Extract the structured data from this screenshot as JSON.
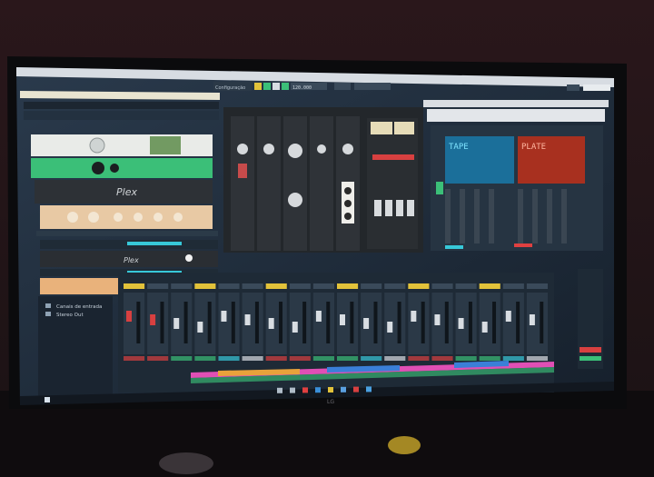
{
  "monitor": {
    "brand_mark": "LG"
  },
  "daw": {
    "toolbar": {
      "zoom_text": "Configuração",
      "tempo_text": "120.000"
    },
    "track_list": [
      {
        "label": "Canais de entrada"
      },
      {
        "label": "Stereo Out"
      }
    ],
    "plugins": {
      "plex_label_1": "Plex",
      "plex_label_2": "Plex",
      "tape_display_text": "TAPE",
      "plate_display_text": "PLATE"
    },
    "mixer": {
      "channel_count": 18
    },
    "colors": {
      "accent_green": "#3bbf78",
      "accent_cyan": "#37c8d8",
      "accent_pink": "#e04fb5",
      "panel": "#1e2a36",
      "rack": "#23272b"
    }
  },
  "taskbar": {
    "icons": [
      "windows-icon",
      "search-icon",
      "task-view-icon",
      "chrome-icon",
      "edge-icon",
      "explorer-icon",
      "store-icon",
      "daw-icon",
      "mail-icon"
    ]
  }
}
